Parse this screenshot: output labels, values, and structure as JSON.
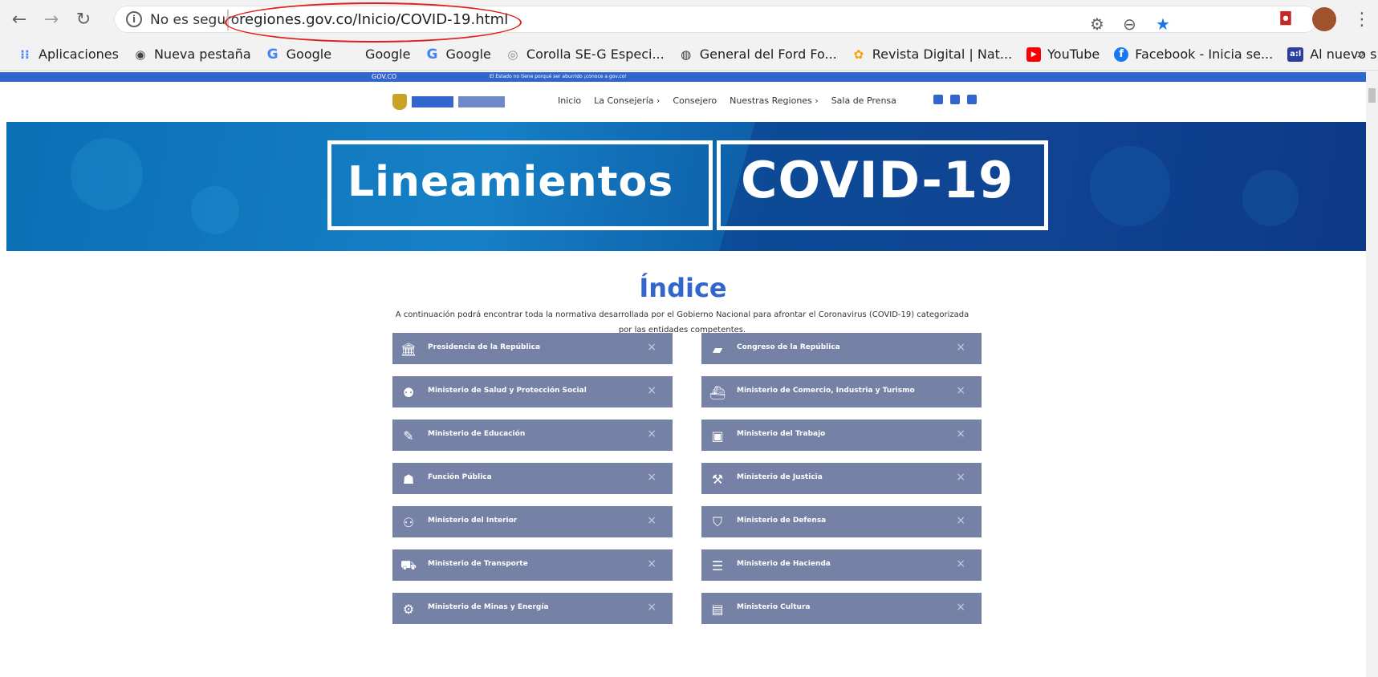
{
  "browser": {
    "insecure_label": "No es seguro",
    "url": "regiones.gov.co/Inicio/COVID-19.html",
    "bookmarks": [
      {
        "label": "Aplicaciones",
        "icon": "apps-grid-icon"
      },
      {
        "label": "Nueva pestaña",
        "icon": "globe-icon"
      },
      {
        "label": "Google",
        "icon": "google-g-icon"
      },
      {
        "label": "Google",
        "icon": "none"
      },
      {
        "label": "Google",
        "icon": "google-g-icon"
      },
      {
        "label": "Corolla SE-G Especi...",
        "icon": "toyota-icon"
      },
      {
        "label": "General del Ford Fo...",
        "icon": "ford-icon"
      },
      {
        "label": "Revista Digital | Nat...",
        "icon": "revista-icon"
      },
      {
        "label": "YouTube",
        "icon": "youtube-icon"
      },
      {
        "label": "Facebook - Inicia se...",
        "icon": "facebook-icon"
      },
      {
        "label": "Al nuevo sistema d...",
        "icon": "al-icon"
      }
    ],
    "more": "»"
  },
  "govbar": {
    "logo": "GOV.CO",
    "message": "El Estado no tiene porqué ser aburrido ¡conoce a gov.co!"
  },
  "header": {
    "nav": [
      "Inicio",
      "La Consejería ›",
      "Consejero",
      "Nuestras Regiones ›",
      "Sala de Prensa"
    ]
  },
  "banner": {
    "word1": "Lineamientos",
    "word2": "COVID-19"
  },
  "index": {
    "title": "Índice",
    "description_line1": "A continuación podrá encontrar toda la normativa desarrollada por el Gobierno Nacional para afrontar el Coronavirus (COVID-19) categorizada",
    "description_line2": "por las entidades competentes."
  },
  "entities": [
    {
      "label": "Presidencia de la República",
      "icon": "government-building-icon"
    },
    {
      "label": "Congreso de la República",
      "icon": "book-icon"
    },
    {
      "label": "Ministerio de Salud y Protección Social",
      "icon": "people-icon"
    },
    {
      "label": "Ministerio de Comercio, Industria y Turismo",
      "icon": "ship-icon"
    },
    {
      "label": "Ministerio de Educación",
      "icon": "pencil-icon"
    },
    {
      "label": "Ministerio del Trabajo",
      "icon": "briefcase-icon"
    },
    {
      "label": "Función Pública",
      "icon": "user-icon"
    },
    {
      "label": "Ministerio de Justicia",
      "icon": "gavel-icon"
    },
    {
      "label": "Ministerio del Interior",
      "icon": "group-icon"
    },
    {
      "label": "Ministerio de Defensa",
      "icon": "shield-icon"
    },
    {
      "label": "Ministerio de Transporte",
      "icon": "road-icon"
    },
    {
      "label": "Ministerio de Hacienda",
      "icon": "database-icon"
    },
    {
      "label": "Ministerio de Minas y Energía",
      "icon": "gears-icon"
    },
    {
      "label": "Ministerio Cultura",
      "icon": "theater-icon"
    }
  ],
  "close_symbol": "×"
}
